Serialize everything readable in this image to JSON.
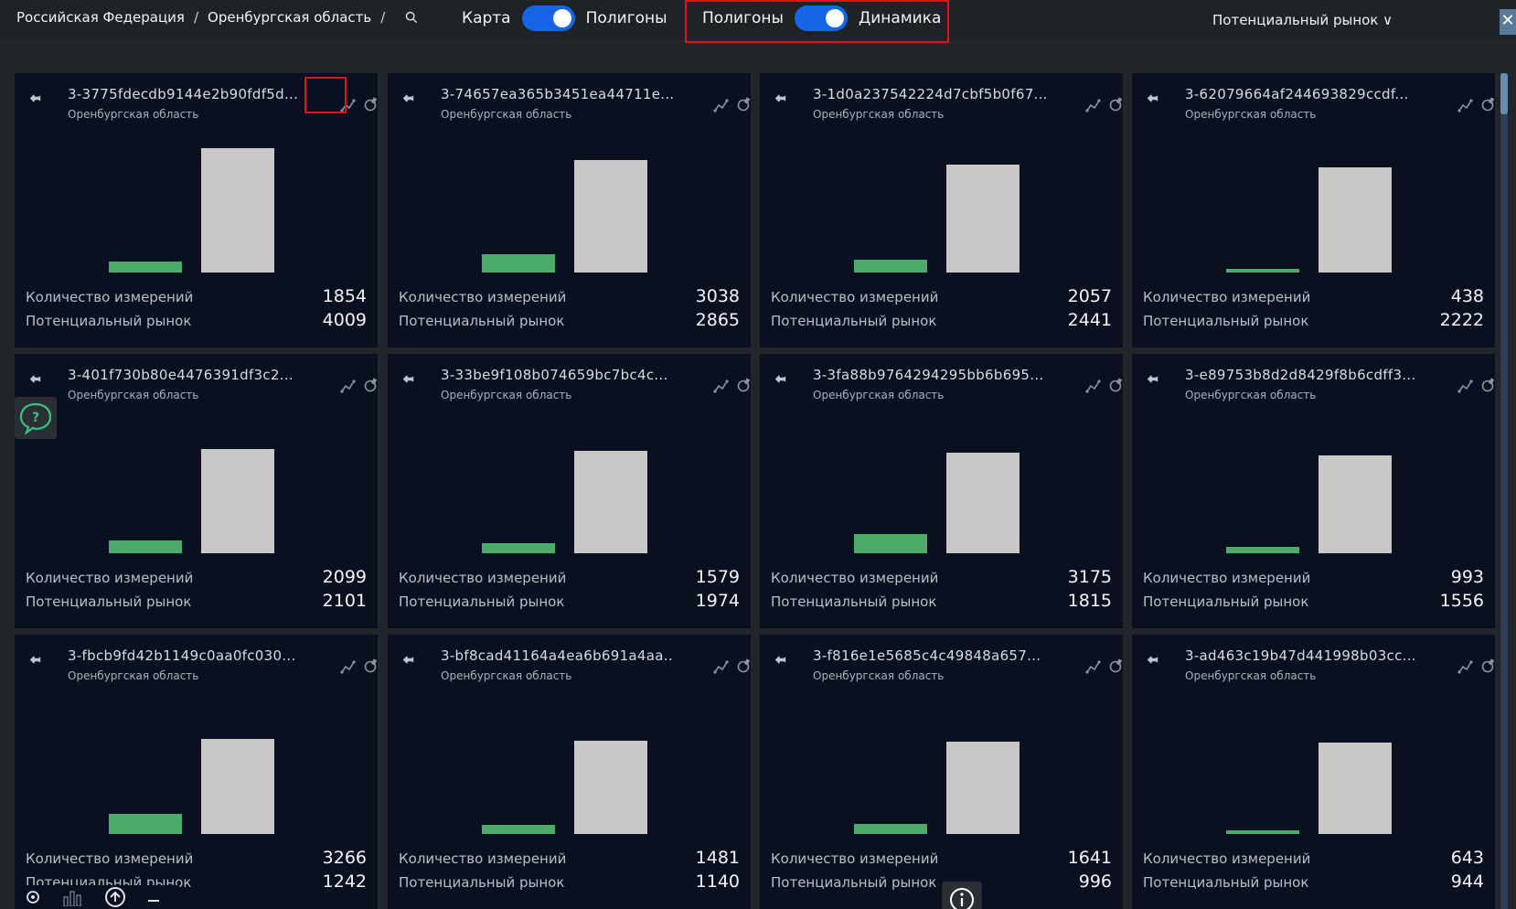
{
  "header": {
    "breadcrumb": [
      "Российская Федерация",
      "Оренбургская область"
    ],
    "toggle_map": {
      "left": "Карта",
      "right": "Полигоны",
      "on": true
    },
    "toggle_dynamics": {
      "left": "Полигоны",
      "right": "Динамика",
      "on": true
    },
    "market_dropdown": "Потенциальный рынок ∨",
    "close_label": "✕"
  },
  "labels": {
    "measurements": "Количество измерений",
    "market": "Потенциальный рынок"
  },
  "colors": {
    "card_bg": "#0b1020",
    "green_bar": "#4caa6a",
    "gray_bar": "#c8c8c8",
    "accent": "#1565e6",
    "highlight": "#e0121b"
  },
  "cards": [
    {
      "title": "3-3775fdecdb9144e2b90fdf5d...",
      "region": "Оренбургская область",
      "measurements": 1854,
      "market": 4009
    },
    {
      "title": "3-74657ea365b3451ea44711e...",
      "region": "Оренбургская область",
      "measurements": 3038,
      "market": 2865
    },
    {
      "title": "3-1d0a237542224d7cbf5b0f67...",
      "region": "Оренбургская область",
      "measurements": 2057,
      "market": 2441
    },
    {
      "title": "3-62079664af244693829ccdf...",
      "region": "Оренбургская область",
      "measurements": 438,
      "market": 2222
    },
    {
      "title": "3-401f730b80e4476391df3c2...",
      "region": "Оренбургская область",
      "measurements": 2099,
      "market": 2101
    },
    {
      "title": "3-33be9f108b074659bc7bc4c...",
      "region": "Оренбургская область",
      "measurements": 1579,
      "market": 1974
    },
    {
      "title": "3-3fa88b9764294295bb6b695...",
      "region": "Оренбургская область",
      "measurements": 3175,
      "market": 1815
    },
    {
      "title": "3-e89753b8d2d8429f8b6cdff3...",
      "region": "Оренбургская область",
      "measurements": 993,
      "market": 1556
    },
    {
      "title": "3-fbcb9fd42b1149c0aa0fc030...",
      "region": "Оренбургская область",
      "measurements": 3266,
      "market": 1242
    },
    {
      "title": "3-bf8cad41164a4ea6b691a4aa...",
      "region": "Оренбургская область",
      "measurements": 1481,
      "market": 1140
    },
    {
      "title": "3-f816e1e5685c4c49848a657...",
      "region": "Оренбургская область",
      "measurements": 1641,
      "market": 996
    },
    {
      "title": "3-ad463c19b47d441998b03cc...",
      "region": "Оренбургская область",
      "measurements": 643,
      "market": 944
    }
  ],
  "icons": {
    "pin": "pin-icon",
    "chart": "chart-line-icon",
    "tool": "settings-icon",
    "search": "search-icon",
    "help": "help-chat-icon",
    "info": "info-icon"
  }
}
